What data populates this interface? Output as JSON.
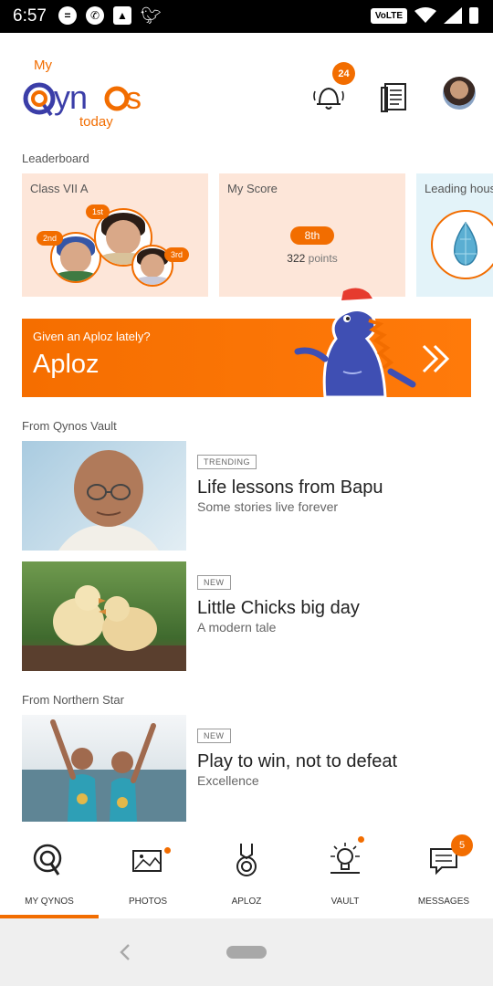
{
  "status_bar": {
    "time": "6:57",
    "network_label": "VoLTE",
    "notification_icons": [
      "message-icon",
      "whatsapp-icon",
      "gallery-icon",
      "twitter-icon"
    ]
  },
  "header": {
    "logo_text_my": "My",
    "logo_text_brand": "Qynos",
    "logo_text_today": "today",
    "notification_count": "24"
  },
  "leaderboard": {
    "label": "Leaderboard",
    "class_card": {
      "title": "Class VII A",
      "positions": [
        "1st",
        "2nd",
        "3rd"
      ]
    },
    "score_card": {
      "title": "My Score",
      "rank": "8th",
      "points_value": "322",
      "points_unit": "points"
    },
    "house_card": {
      "title": "Leading hous"
    }
  },
  "aploz_banner": {
    "subtitle": "Given an Aploz lately?",
    "title": "Aploz"
  },
  "vault": {
    "label": "From Qynos Vault",
    "articles": [
      {
        "tag": "TRENDING",
        "title": "Life lessons from Bapu",
        "subtitle": "Some stories live forever"
      },
      {
        "tag": "NEW",
        "title": "Little Chicks big day",
        "subtitle": "A modern tale"
      }
    ]
  },
  "northern_star": {
    "label": "From Northern Star",
    "articles": [
      {
        "tag": "NEW",
        "title": "Play to win, not to defeat",
        "subtitle": "Excellence"
      }
    ]
  },
  "bottom_nav": {
    "items": [
      {
        "label": "MY QYNOS",
        "icon": "qynos-logo-icon"
      },
      {
        "label": "PHOTOS",
        "icon": "photos-icon"
      },
      {
        "label": "APLOZ",
        "icon": "medal-icon"
      },
      {
        "label": "VAULT",
        "icon": "lightbulb-icon"
      },
      {
        "label": "MESSAGES",
        "icon": "messages-icon"
      }
    ],
    "messages_count": "5",
    "active_index": 0
  },
  "colors": {
    "accent": "#f26d00",
    "card_bg": "#fde6d9",
    "house_card_bg": "#e3f3f9",
    "brand_blue": "#3b3ea8"
  }
}
